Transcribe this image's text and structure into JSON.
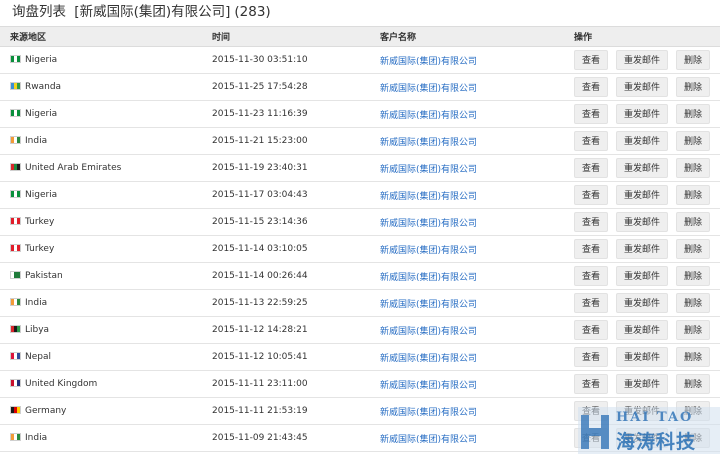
{
  "header": {
    "title": "询盘列表",
    "company": "[新威国际(集团)有限公司]",
    "count": "(283)"
  },
  "columns": {
    "source": "来源地区",
    "time": "时间",
    "customer": "客户名称",
    "actions": "操作"
  },
  "row_actions": {
    "view": "查看",
    "resend": "重发邮件",
    "delete": "删除"
  },
  "rows": [
    {
      "country": "Nigeria",
      "flag": [
        "#0a8f3c",
        "#ffffff",
        "#0a8f3c"
      ],
      "time": "2015-11-30 03:51:10",
      "customer": "新威国际(集团)有限公司"
    },
    {
      "country": "Rwanda",
      "flag": [
        "#3a8fd6",
        "#f2d21b",
        "#2e9a47"
      ],
      "time": "2015-11-25 17:54:28",
      "customer": "新威国际(集团)有限公司"
    },
    {
      "country": "Nigeria",
      "flag": [
        "#0a8f3c",
        "#ffffff",
        "#0a8f3c"
      ],
      "time": "2015-11-23 11:16:39",
      "customer": "新威国际(集团)有限公司"
    },
    {
      "country": "India",
      "flag": [
        "#f29b38",
        "#ffffff",
        "#2a8a3e"
      ],
      "time": "2015-11-21 15:23:00",
      "customer": "新威国际(集团)有限公司"
    },
    {
      "country": "United Arab Emirates",
      "flag": [
        "#d9262b",
        "#1f8a3f",
        "#1a1a1a"
      ],
      "time": "2015-11-19 23:40:31",
      "customer": "新威国际(集团)有限公司"
    },
    {
      "country": "Nigeria",
      "flag": [
        "#0a8f3c",
        "#ffffff",
        "#0a8f3c"
      ],
      "time": "2015-11-17 03:04:43",
      "customer": "新威国际(集团)有限公司"
    },
    {
      "country": "Turkey",
      "flag": [
        "#e11d2a",
        "#ffffff",
        "#e11d2a"
      ],
      "time": "2015-11-15 23:14:36",
      "customer": "新威国际(集团)有限公司"
    },
    {
      "country": "Turkey",
      "flag": [
        "#e11d2a",
        "#ffffff",
        "#e11d2a"
      ],
      "time": "2015-11-14 03:10:05",
      "customer": "新威国际(集团)有限公司"
    },
    {
      "country": "Pakistan",
      "flag": [
        "#ffffff",
        "#1f7a3a",
        "#1f7a3a"
      ],
      "time": "2015-11-14 00:26:44",
      "customer": "新威国际(集团)有限公司"
    },
    {
      "country": "India",
      "flag": [
        "#f29b38",
        "#ffffff",
        "#2a8a3e"
      ],
      "time": "2015-11-13 22:59:25",
      "customer": "新威国际(集团)有限公司"
    },
    {
      "country": "Libya",
      "flag": [
        "#d9262b",
        "#1a1a1a",
        "#2a9a48"
      ],
      "time": "2015-11-12 14:28:21",
      "customer": "新威国际(集团)有限公司"
    },
    {
      "country": "Nepal",
      "flag": [
        "#dc143c",
        "#ffffff",
        "#2d4a9a"
      ],
      "time": "2015-11-12 10:05:41",
      "customer": "新威国际(集团)有限公司"
    },
    {
      "country": "United Kingdom",
      "flag": [
        "#c8102e",
        "#ffffff",
        "#20307a"
      ],
      "time": "2015-11-11 23:11:00",
      "customer": "新威国际(集团)有限公司"
    },
    {
      "country": "Germany",
      "flag": [
        "#1a1a1a",
        "#dd0000",
        "#ffcc00"
      ],
      "time": "2015-11-11 21:53:19",
      "customer": "新威国际(集团)有限公司"
    },
    {
      "country": "India",
      "flag": [
        "#f29b38",
        "#ffffff",
        "#2a8a3e"
      ],
      "time": "2015-11-09 21:43:45",
      "customer": "新威国际(集团)有限公司"
    }
  ],
  "watermark": {
    "en": "HAI TAO",
    "cn": "海涛科技"
  }
}
